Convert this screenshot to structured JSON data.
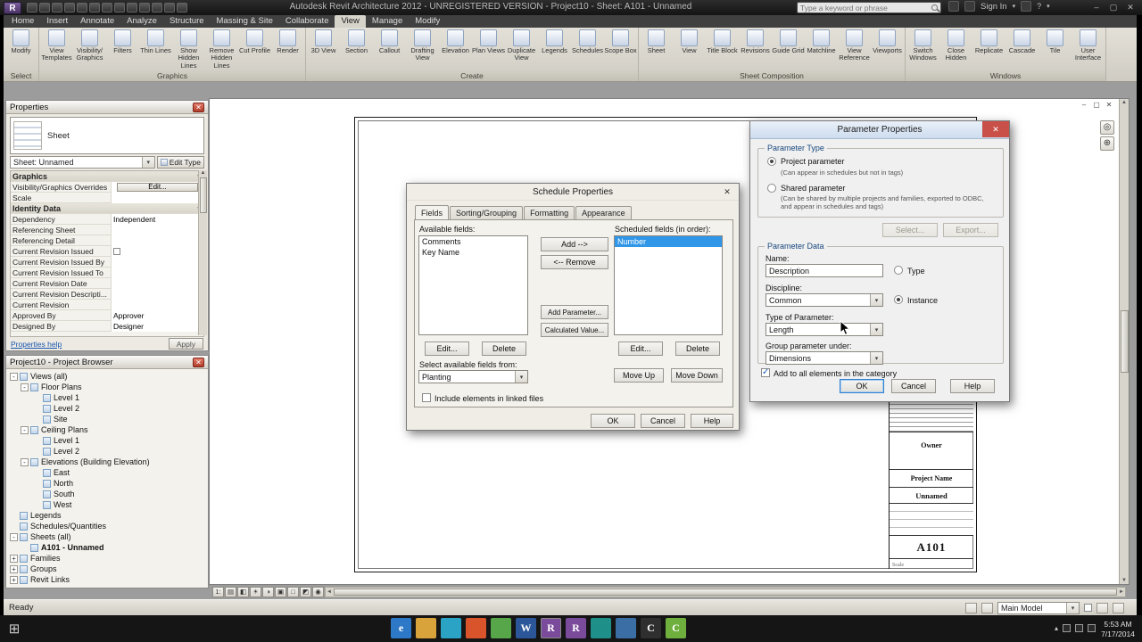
{
  "titlebar": {
    "app_title": "Autodesk Revit Architecture 2012 - UNREGISTERED VERSION  -  Project10 - Sheet: A101 - Unnamed",
    "search_placeholder": "Type a keyword or phrase",
    "sign_in_label": "Sign In",
    "quick_access_icons": [
      {
        "name": "open-icon"
      },
      {
        "name": "save-icon"
      },
      {
        "name": "sync-icon"
      },
      {
        "name": "undo-icon"
      },
      {
        "name": "redo-icon"
      },
      {
        "name": "print-icon"
      },
      {
        "name": "measure-icon"
      },
      {
        "name": "dimension-icon"
      },
      {
        "name": "tag-icon"
      },
      {
        "name": "text-icon"
      },
      {
        "name": "3d-view-icon"
      },
      {
        "name": "section-icon"
      },
      {
        "name": "thin-lines-icon"
      }
    ]
  },
  "ribbon": {
    "tabs": [
      {
        "label": "Home"
      },
      {
        "label": "Insert"
      },
      {
        "label": "Annotate"
      },
      {
        "label": "Analyze"
      },
      {
        "label": "Structure"
      },
      {
        "label": "Massing & Site"
      },
      {
        "label": "Collaborate"
      },
      {
        "label": "View",
        "active": true
      },
      {
        "label": "Manage"
      },
      {
        "label": "Modify"
      }
    ],
    "groups": [
      {
        "label": "Select",
        "buttons": [
          {
            "label": "Modify",
            "icon": "modify-arrow-icon"
          }
        ]
      },
      {
        "label": "Graphics",
        "buttons": [
          {
            "label": "View Templates",
            "icon": "view-templates-icon"
          },
          {
            "label": "Visibility/ Graphics",
            "icon": "visibility-graphics-icon"
          },
          {
            "label": "Filters",
            "icon": "filters-icon"
          },
          {
            "label": "Thin Lines",
            "icon": "thin-lines-icon"
          },
          {
            "label": "Show Hidden Lines",
            "icon": "show-hidden-lines-icon"
          },
          {
            "label": "Remove Hidden Lines",
            "icon": "remove-hidden-lines-icon"
          },
          {
            "label": "Cut Profile",
            "icon": "cut-profile-icon"
          },
          {
            "label": "Render",
            "icon": "render-icon"
          }
        ]
      },
      {
        "label": "Create",
        "buttons": [
          {
            "label": "3D View",
            "icon": "3d-view-icon"
          },
          {
            "label": "Section",
            "icon": "section-icon"
          },
          {
            "label": "Callout",
            "icon": "callout-icon"
          },
          {
            "label": "Drafting View",
            "icon": "drafting-view-icon"
          },
          {
            "label": "Elevation",
            "icon": "elevation-icon"
          },
          {
            "label": "Plan Views",
            "icon": "plan-views-icon"
          },
          {
            "label": "Duplicate View",
            "icon": "duplicate-view-icon"
          },
          {
            "label": "Legends",
            "icon": "legends-icon"
          },
          {
            "label": "Schedules",
            "icon": "schedules-icon"
          },
          {
            "label": "Scope Box",
            "icon": "scope-box-icon"
          }
        ]
      },
      {
        "label": "Sheet Composition",
        "buttons": [
          {
            "label": "Sheet",
            "icon": "sheet-icon"
          },
          {
            "label": "View",
            "icon": "view-icon"
          },
          {
            "label": "Title Block",
            "icon": "title-block-icon"
          },
          {
            "label": "Revisions",
            "icon": "revisions-icon"
          },
          {
            "label": "Guide Grid",
            "icon": "guide-grid-icon"
          },
          {
            "label": "Matchline",
            "icon": "matchline-icon"
          },
          {
            "label": "View Reference",
            "icon": "view-reference-icon"
          },
          {
            "label": "Viewports",
            "icon": "viewports-icon"
          }
        ]
      },
      {
        "label": "Windows",
        "buttons": [
          {
            "label": "Switch Windows",
            "icon": "switch-windows-icon"
          },
          {
            "label": "Close Hidden",
            "icon": "close-hidden-icon"
          },
          {
            "label": "Replicate",
            "icon": "replicate-icon"
          },
          {
            "label": "Cascade",
            "icon": "cascade-icon"
          },
          {
            "label": "Tile",
            "icon": "tile-icon"
          },
          {
            "label": "User Interface",
            "icon": "user-interface-icon"
          }
        ]
      }
    ]
  },
  "properties_panel": {
    "title": "Properties",
    "type_name": "Sheet",
    "type_selector": "Sheet: Unnamed",
    "edit_type_label": "Edit Type",
    "rows": [
      {
        "label": "Graphics",
        "kind": "section"
      },
      {
        "label": "Visibility/Graphics Overrides",
        "value": "Edit...",
        "kind": "button"
      },
      {
        "label": "Scale",
        "value": "",
        "kind": "value"
      },
      {
        "label": "Identity Data",
        "kind": "section"
      },
      {
        "label": "Dependency",
        "value": "Independent",
        "kind": "value"
      },
      {
        "label": "Referencing Sheet",
        "value": "",
        "kind": "value"
      },
      {
        "label": "Referencing Detail",
        "value": "",
        "kind": "value"
      },
      {
        "label": "Current Revision Issued",
        "value": "",
        "kind": "checkbox"
      },
      {
        "label": "Current Revision Issued By",
        "value": "",
        "kind": "value"
      },
      {
        "label": "Current Revision Issued To",
        "value": "",
        "kind": "value"
      },
      {
        "label": "Current Revision Date",
        "value": "",
        "kind": "value"
      },
      {
        "label": "Current Revision Descripti...",
        "value": "",
        "kind": "value"
      },
      {
        "label": "Current Revision",
        "value": "",
        "kind": "value"
      },
      {
        "label": "Approved By",
        "value": "Approver",
        "kind": "value"
      },
      {
        "label": "Designed By",
        "value": "Designer",
        "kind": "value"
      }
    ],
    "help_link_label": "Properties help",
    "apply_label": "Apply"
  },
  "project_browser": {
    "title": "Project10 - Project Browser",
    "items": [
      {
        "label": "Views (all)",
        "depth": 0,
        "expand": "-"
      },
      {
        "label": "Floor Plans",
        "depth": 1,
        "expand": "-"
      },
      {
        "label": "Level 1",
        "depth": 2
      },
      {
        "label": "Level 2",
        "depth": 2
      },
      {
        "label": "Site",
        "depth": 2
      },
      {
        "label": "Ceiling Plans",
        "depth": 1,
        "expand": "-"
      },
      {
        "label": "Level 1",
        "depth": 2
      },
      {
        "label": "Level 2",
        "depth": 2
      },
      {
        "label": "Elevations (Building Elevation)",
        "depth": 1,
        "expand": "-"
      },
      {
        "label": "East",
        "depth": 2
      },
      {
        "label": "North",
        "depth": 2
      },
      {
        "label": "South",
        "depth": 2
      },
      {
        "label": "West",
        "depth": 2
      },
      {
        "label": "Legends",
        "depth": 0
      },
      {
        "label": "Schedules/Quantities",
        "depth": 0
      },
      {
        "label": "Sheets (all)",
        "depth": 0,
        "expand": "-"
      },
      {
        "label": "A101 - Unnamed",
        "depth": 1,
        "bold": true
      },
      {
        "label": "Families",
        "depth": 0,
        "expand": "+"
      },
      {
        "label": "Groups",
        "depth": 0,
        "expand": "+"
      },
      {
        "label": "Revit Links",
        "depth": 0,
        "expand": "+"
      }
    ]
  },
  "sheet": {
    "owner_label": "Owner",
    "project_name_label": "Project Name",
    "sheet_name": "Unnamed",
    "sheet_number": "A101",
    "scale_label": "Scale"
  },
  "view_controls": {
    "icons": [
      {
        "name": "scale-icon",
        "glyph": "1:"
      },
      {
        "name": "detail-level-icon",
        "glyph": "▤"
      },
      {
        "name": "visual-style-icon",
        "glyph": "◧"
      },
      {
        "name": "sun-path-icon",
        "glyph": "☀"
      },
      {
        "name": "shadows-icon",
        "glyph": "◑"
      },
      {
        "name": "crop-view-icon",
        "glyph": "▣"
      },
      {
        "name": "show-crop-region-icon",
        "glyph": "□"
      },
      {
        "name": "temporary-hide-isolate-icon",
        "glyph": "◩"
      },
      {
        "name": "reveal-hidden-elements-icon",
        "glyph": "◉"
      }
    ]
  },
  "statusbar": {
    "ready_label": "Ready",
    "main_model_label": "Main Model"
  },
  "taskbar": {
    "clock_time": "5:53 AM",
    "clock_date": "7/17/2014",
    "apps": [
      {
        "name": "internet-explorer-icon",
        "color": "#2e79c7",
        "glyph": "e"
      },
      {
        "name": "file-explorer-icon",
        "color": "#d8a33b",
        "glyph": ""
      },
      {
        "name": "app-teal-icon",
        "color": "#2ba3c4",
        "glyph": ""
      },
      {
        "name": "app-orange-icon",
        "color": "#d9542b",
        "glyph": ""
      },
      {
        "name": "app-green-icon",
        "color": "#57a64a",
        "glyph": ""
      },
      {
        "name": "word-icon",
        "color": "#2b579a",
        "glyph": "W"
      },
      {
        "name": "revit-icon",
        "color": "#7a4b9b",
        "glyph": "R",
        "active": true
      },
      {
        "name": "revit-icon",
        "color": "#7a4b9b",
        "glyph": "R"
      },
      {
        "name": "app-cyan-icon",
        "color": "#1f8f8a",
        "glyph": ""
      },
      {
        "name": "app-blue-icon",
        "color": "#3a6ea5",
        "glyph": ""
      },
      {
        "name": "cmd-icon",
        "color": "#2f2f2f",
        "glyph": "C"
      },
      {
        "name": "civil-icon",
        "color": "#6faf3e",
        "glyph": "C"
      }
    ]
  },
  "schedule_dialog": {
    "title": "Schedule Properties",
    "tabs": [
      {
        "label": "Fields",
        "active": true
      },
      {
        "label": "Sorting/Grouping"
      },
      {
        "label": "Formatting"
      },
      {
        "label": "Appearance"
      }
    ],
    "available_fields_label": "Available fields:",
    "available_fields": [
      {
        "label": "Comments"
      },
      {
        "label": "Key Name"
      }
    ],
    "scheduled_fields_label": "Scheduled fields (in order):",
    "scheduled_fields": [
      {
        "label": "Number",
        "selected": true
      }
    ],
    "add_button": "Add -->",
    "remove_button": "<-- Remove",
    "add_parameter_button": "Add Parameter...",
    "calculated_value_button": "Calculated Value...",
    "edit_button": "Edit...",
    "delete_button": "Delete",
    "select_available_from_label": "Select available fields from:",
    "select_available_from_value": "Planting",
    "include_linked_label": "Include elements in linked files",
    "move_up_button": "Move Up",
    "move_down_button": "Move Down",
    "ok_button": "OK",
    "cancel_button": "Cancel",
    "help_button": "Help"
  },
  "parameter_dialog": {
    "title": "Parameter Properties",
    "parameter_type_group": "Parameter Type",
    "project_parameter_label": "Project parameter",
    "project_parameter_desc": "(Can appear in schedules but not in tags)",
    "shared_parameter_label": "Shared parameter",
    "shared_parameter_desc": "(Can be shared by multiple projects and families, exported to ODBC, and appear in schedules and tags)",
    "select_button": "Select...",
    "export_button": "Export...",
    "parameter_data_group": "Parameter Data",
    "name_label": "Name:",
    "name_value": "Description",
    "discipline_label": "Discipline:",
    "discipline_value": "Common",
    "type_of_parameter_label": "Type of Parameter:",
    "type_of_parameter_value": "Length",
    "group_under_label": "Group parameter under:",
    "group_under_value": "Dimensions",
    "type_radio_label": "Type",
    "instance_radio_label": "Instance",
    "add_all_label": "Add to all elements in the category",
    "ok_button": "OK",
    "cancel_button": "Cancel",
    "help_button": "Help"
  },
  "colors": {
    "selection_blue": "#2f96e8",
    "ribbon_bg": "#d6d3ca",
    "workspace_bg": "#9c9c9c",
    "dialog_bg": "#f0f0f0",
    "taskbar_bg": "#151515",
    "active_dialog_title": "#cddcee",
    "close_button_red": "#c85048"
  }
}
